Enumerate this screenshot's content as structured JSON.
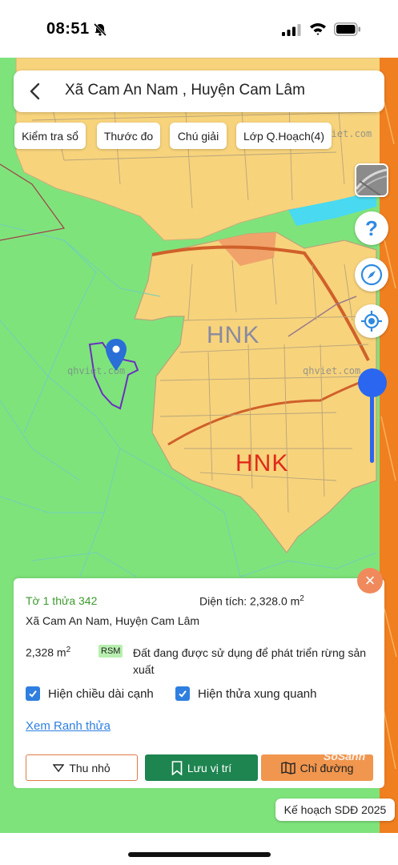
{
  "status_bar": {
    "time": "08:51",
    "icons": [
      "bell-slash-icon",
      "signal-icon",
      "wifi-icon",
      "battery-icon"
    ]
  },
  "search": {
    "title": "Xã Cam An Nam , Huyện Cam Lâm"
  },
  "chips": [
    "Kiểm tra sổ",
    "Thước đo",
    "Chú giải",
    "Lớp Q.Hoạch(4)"
  ],
  "map": {
    "labels": [
      "HNK",
      "HNK"
    ],
    "watermarks": [
      "qhviet.com",
      "qhviet.com",
      "qhviet.com"
    ],
    "colors": {
      "forest_land": "#7fe37b",
      "agricultural_land": "#f7d37c",
      "water": "#49d9f0",
      "road_boundary": "#f07f20",
      "parcel_outline": "#6a2fc0",
      "marker": "#2a6fd6"
    },
    "zoom_level": 0.85
  },
  "controls": {
    "icons": [
      "layer-thumbnail-icon",
      "help-icon",
      "compass-icon",
      "locate-icon"
    ],
    "help_glyph": "?"
  },
  "panel": {
    "parcel_id": "Tờ 1 thửa 342",
    "area_label": "Diện tích: 2,328.0 m",
    "area_sup": "2",
    "location": "Xã Cam An Nam, Huyện Cam Lâm",
    "size_value": "2,328 m",
    "size_sup": "2",
    "land_code": "RSM",
    "land_description": "Đất đang được sử dụng để phát triển rừng sản xuất",
    "checkbox_edges": {
      "label": "Hiện chiều dài cạnh",
      "checked": true
    },
    "checkbox_neighbors": {
      "label": "Hiện thửa xung quanh",
      "checked": true
    },
    "link_label": "Xem Ranh thửa",
    "buttons": {
      "shrink": "Thu nhỏ",
      "save": "Lưu vị trí",
      "route": "Chỉ đường"
    },
    "close_glyph": "×"
  },
  "plan_badge": "Kế hoạch SDĐ 2025",
  "corner_watermark": "SoSanh"
}
